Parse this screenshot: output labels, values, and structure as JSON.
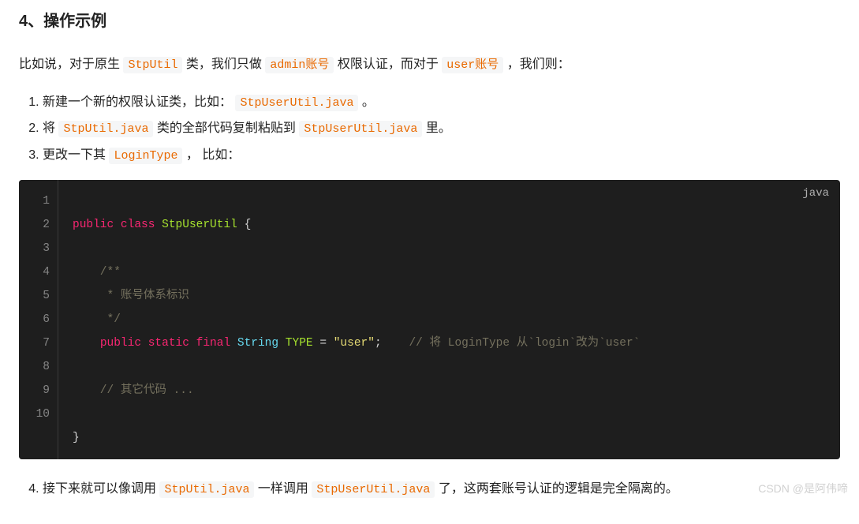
{
  "section": {
    "title": "4、操作示例"
  },
  "intro": {
    "p1": "比如说，对于原生 ",
    "code1": "StpUtil",
    "p2": " 类，我们只做 ",
    "code2": "admin账号",
    "p3": " 权限认证，而对于 ",
    "code3": "user账号",
    "p4": " ，我们则："
  },
  "steps": {
    "s1a": "新建一个新的权限认证类，比如： ",
    "s1code": "StpUserUtil.java",
    "s1b": " 。",
    "s2a": "将 ",
    "s2code1": "StpUtil.java",
    "s2b": " 类的全部代码复制粘贴到 ",
    "s2code2": "StpUserUtil.java",
    "s2c": " 里。",
    "s3a": "更改一下其 ",
    "s3code": "LoginType",
    "s3b": " ， 比如："
  },
  "code": {
    "lang": "java",
    "lines": [
      "1",
      "2",
      "3",
      "4",
      "5",
      "6",
      "7",
      "8",
      "9",
      "10"
    ],
    "l1": {
      "kw_public": "public",
      "kw_class": "class",
      "cls": "StpUserUtil",
      "brace_open": "{"
    },
    "l3": "    /**",
    "l4": "     * 账号体系标识",
    "l5": "     */",
    "l6": {
      "kw_public": "public",
      "kw_static": "static",
      "kw_final": "final",
      "type": "String",
      "var": "TYPE",
      "eq": "=",
      "str": "\"user\"",
      "semi": ";",
      "comment": "// 将 LoginType 从`login`改为`user`"
    },
    "l8": "    // 其它代码 ...",
    "l10": "}"
  },
  "step4": {
    "a": "接下来就可以像调用 ",
    "code1": "StpUtil.java",
    "b": " 一样调用 ",
    "code2": "StpUserUtil.java",
    "c": " 了，这两套账号认证的逻辑是完全隔离的。"
  },
  "watermark": "CSDN @是阿伟啼"
}
